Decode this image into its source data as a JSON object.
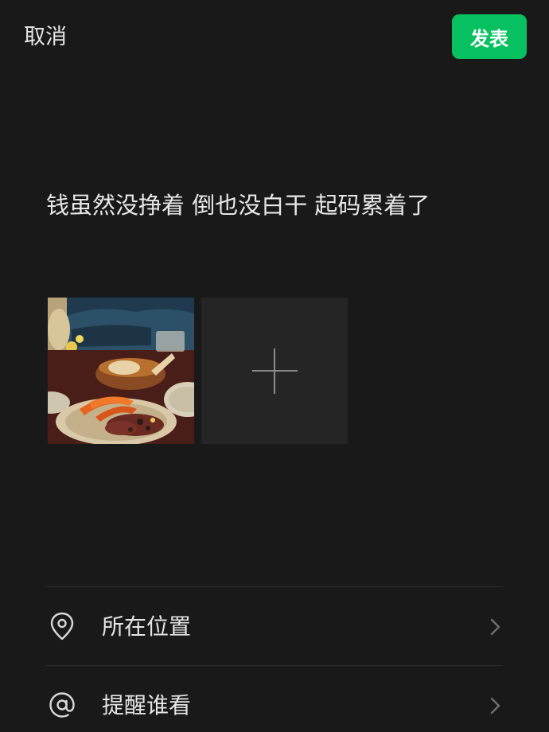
{
  "header": {
    "cancel_label": "取消",
    "publish_label": "发表",
    "publish_color": "#07c160"
  },
  "post": {
    "text": "钱虽然没挣着 倒也没白干 起码累着了"
  },
  "media": {
    "photos": [
      {
        "icon": "photo-thumbnail"
      }
    ],
    "add_icon": "plus-icon"
  },
  "options": [
    {
      "label": "所在位置",
      "icon": "location-pin-icon"
    },
    {
      "label": "提醒谁看",
      "icon": "at-icon"
    }
  ]
}
